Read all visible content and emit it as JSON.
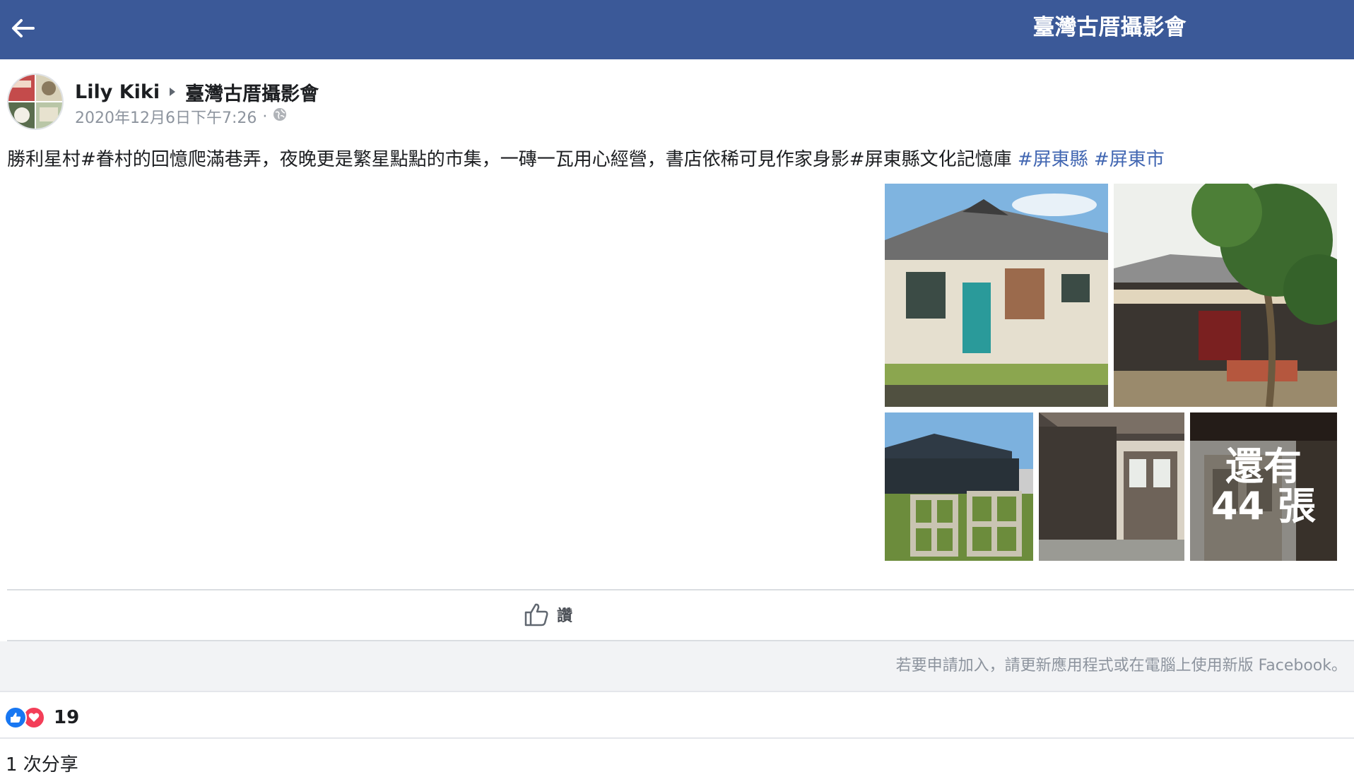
{
  "header": {
    "title": "臺灣古厝攝影會",
    "back_icon": "arrow-left-icon"
  },
  "post": {
    "author": "Lily Kiki",
    "group": "臺灣古厝攝影會",
    "timestamp": "2020年12月6日下午7:26",
    "separator": "·",
    "privacy_icon": "globe-icon",
    "text_main": "勝利星村#眷村的回憶爬滿巷弄，夜晚更是繁星點點的市集，一磚一瓦用心經營，書店依稀可見作家身影#屏東縣文化記憶庫",
    "hashtags": [
      "#屏東縣",
      "#屏東市"
    ],
    "more_photos_label": "還有 44 張"
  },
  "actions": {
    "like_label": "讚"
  },
  "join_notice": "若要申請加入，請更新應用程式或在電腦上使用新版 Facebook。",
  "reactions": {
    "count": "19",
    "types": [
      "like",
      "love"
    ]
  },
  "shares_label": "1 次分享",
  "colors": {
    "header_bg": "#3b5998",
    "hashtag": "#4267b2",
    "like_blue": "#1877f2",
    "love_red": "#f33e58"
  }
}
